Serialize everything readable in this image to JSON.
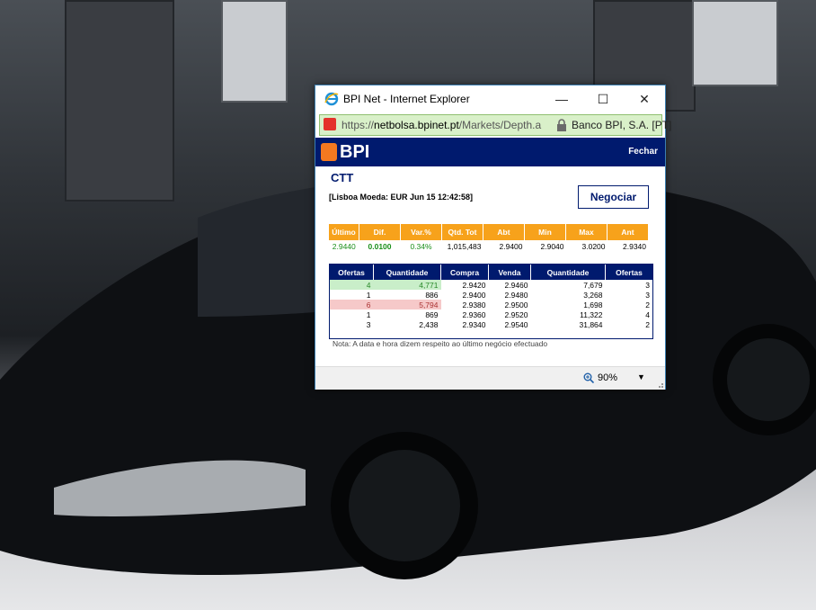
{
  "window": {
    "title": "BPI Net - Internet Explorer",
    "minimize_glyph": "—",
    "maximize_glyph": "☐",
    "close_glyph": "✕"
  },
  "address_bar": {
    "url_protocol": "https://",
    "url_domain": "netbolsa.bpinet.pt",
    "url_path": "/Markets/Depth.a",
    "site_identity": "Banco BPI, S.A. [PT]"
  },
  "page": {
    "logo_text": "BPI",
    "close_link": "Fechar",
    "stock_symbol": "CTT",
    "stock_info": "[Lisboa   Moeda: EUR   Jun 15 12:42:58]",
    "trade_button": "Negociar",
    "quote": {
      "headers": [
        "Último",
        "Dif.",
        "Var.%",
        "Qtd. Tot",
        "Abt",
        "Min",
        "Max",
        "Ant"
      ],
      "values": [
        "2.9440",
        "0.0100",
        "0.34%",
        "1,015,483",
        "2.9400",
        "2.9040",
        "3.0200",
        "2.9340"
      ]
    },
    "depth": {
      "headers": [
        "Ofertas",
        "Quantidade",
        "Compra",
        "Venda",
        "Quantidade",
        "Ofertas"
      ],
      "rows": [
        [
          "4",
          "4,771",
          "2.9420",
          "2.9460",
          "7,679",
          "3"
        ],
        [
          "1",
          "886",
          "2.9400",
          "2.9480",
          "3,268",
          "3"
        ],
        [
          "6",
          "5,794",
          "2.9380",
          "2.9500",
          "1,698",
          "2"
        ],
        [
          "1",
          "869",
          "2.9360",
          "2.9520",
          "11,322",
          "4"
        ],
        [
          "3",
          "2,438",
          "2.9340",
          "2.9540",
          "31,864",
          "2"
        ]
      ]
    },
    "note": "Nota: A data e hora dizem respeito ao último negócio efectuado"
  },
  "statusbar": {
    "zoom_level": "90%",
    "dropdown_glyph": "▼"
  },
  "colors": {
    "bpi_navy": "#001a6e",
    "bpi_orange": "#f7a21b",
    "address_green": "#d9f0c9"
  }
}
